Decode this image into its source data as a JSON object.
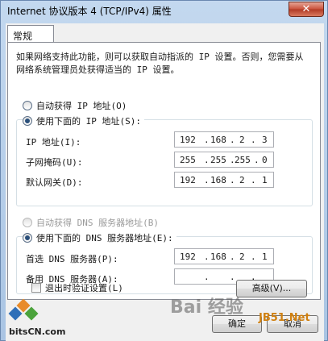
{
  "window": {
    "title": "Internet 协议版本 4 (TCP/IPv4) 属性",
    "close_glyph": "✕"
  },
  "tabs": [
    {
      "label": "常规"
    }
  ],
  "description": "如果网络支持此功能，则可以获取自动指派的 IP 设置。否则，您需要从网络系统管理员处获得适当的 IP 设置。",
  "ip_section": {
    "auto_option": {
      "label": "自动获得 IP 地址(O)",
      "checked": false
    },
    "manual_option": {
      "label": "使用下面的 IP 地址(S):",
      "checked": true
    },
    "fields": [
      {
        "label": "IP 地址(I):",
        "octets": [
          "192",
          "168",
          "2",
          "3"
        ]
      },
      {
        "label": "子网掩码(U):",
        "octets": [
          "255",
          "255",
          "255",
          "0"
        ]
      },
      {
        "label": "默认网关(D):",
        "octets": [
          "192",
          "168",
          "2",
          "1"
        ]
      }
    ]
  },
  "dns_section": {
    "auto_option": {
      "label": "自动获得 DNS 服务器地址(B)",
      "checked": false,
      "disabled": true
    },
    "manual_option": {
      "label": "使用下面的 DNS 服务器地址(E):",
      "checked": true
    },
    "fields": [
      {
        "label": "首选 DNS 服务器(P):",
        "octets": [
          "192",
          "168",
          "2",
          "1"
        ]
      },
      {
        "label": "备用 DNS 服务器(A):",
        "octets": [
          "",
          "",
          "",
          ""
        ]
      }
    ]
  },
  "validate_checkbox": {
    "label": "退出时验证设置(L)",
    "checked": false
  },
  "buttons": {
    "advanced": "高级(V)...",
    "ok": "确定",
    "cancel": "取消"
  },
  "watermarks": {
    "bitscn": "bitsCN.com",
    "jb51": "JB51.Net",
    "baidu": "Bai 经验"
  }
}
